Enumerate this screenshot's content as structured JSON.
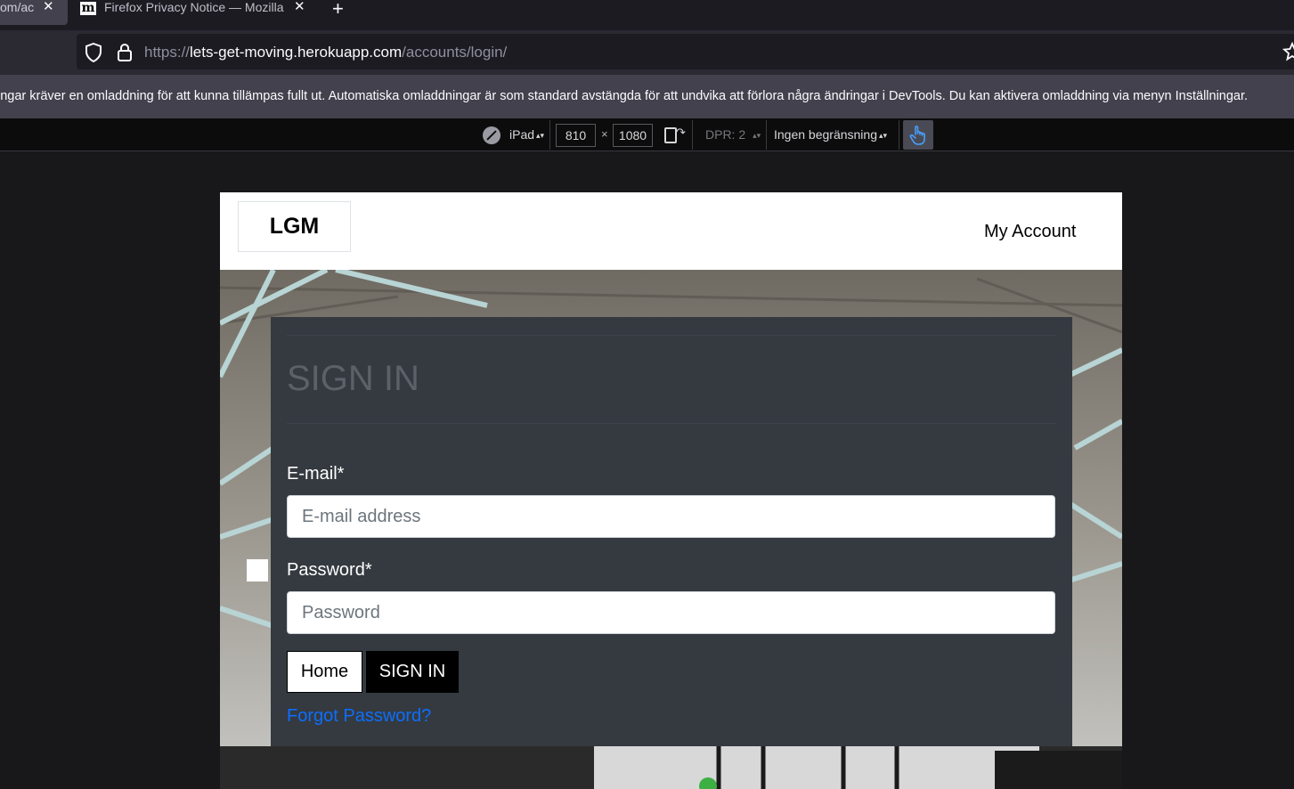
{
  "browser": {
    "tabs": [
      {
        "title": "om/ac",
        "active": true
      },
      {
        "title": "Firefox Privacy Notice — Mozilla",
        "favicon": "m",
        "active": false
      }
    ],
    "new_tab_icon": "plus-icon",
    "url_scheme": "https://",
    "url_host": "lets-get-moving.herokuapp.com",
    "url_path": "/accounts/login/"
  },
  "notice": {
    "text": "ingar kräver en omladdning för att kunna tillämpas fullt ut. Automatiska omladdningar är som standard avstängda för att undvika att förlora några ändringar i DevTools. Du kan aktivera omladdning via menyn Inställningar."
  },
  "rdm": {
    "device": "iPad",
    "width": "810",
    "times": "×",
    "height": "1080",
    "dpr": "DPR: 2",
    "throttle": "Ingen begränsning"
  },
  "site": {
    "logo": "LGM",
    "nav_account": "My Account",
    "form": {
      "title": "SIGN IN",
      "email_label": "E-mail*",
      "email_placeholder": "E-mail address",
      "password_label": "Password*",
      "password_placeholder": "Password",
      "home_button": "Home",
      "signin_button": "SIGN IN",
      "forgot_link": "Forgot Password?"
    }
  },
  "colors": {
    "card_bg": "#343a40",
    "link": "#0d6efd",
    "title_muted": "#5c6168"
  }
}
